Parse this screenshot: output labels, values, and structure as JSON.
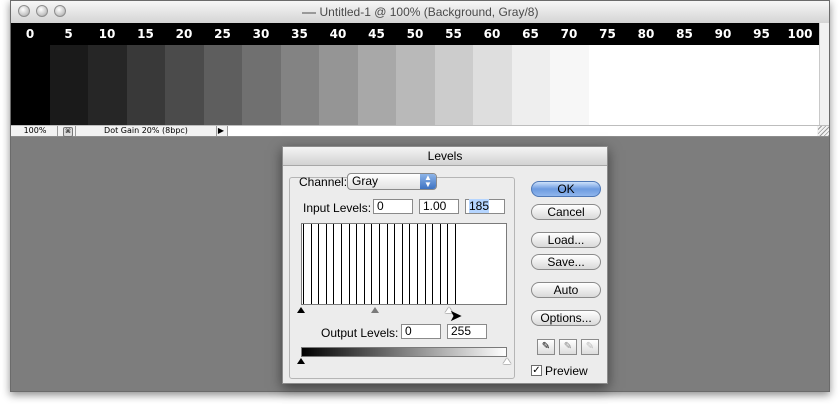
{
  "window": {
    "title": "Untitled-1 @ 100% (Background, Gray/8)"
  },
  "canvas": {
    "scale_labels": [
      "0",
      "5",
      "10",
      "15",
      "20",
      "25",
      "30",
      "35",
      "40",
      "45",
      "50",
      "55",
      "60",
      "65",
      "70",
      "75",
      "80",
      "85",
      "90",
      "95",
      "100"
    ],
    "swatch_colors": [
      "#000000",
      "#1a1a1a",
      "#262626",
      "#393939",
      "#4b4b4b",
      "#5e5e5e",
      "#707070",
      "#838383",
      "#959595",
      "#a8a8a8",
      "#b9b9b9",
      "#cccccc",
      "#dedede",
      "#eeeeee",
      "#f7f7f7",
      "#ffffff",
      "#ffffff",
      "#ffffff",
      "#ffffff",
      "#ffffff",
      "#ffffff"
    ]
  },
  "statusbar": {
    "zoom": "100%",
    "info": "Dot Gain 20% (8bpc)"
  },
  "dialog": {
    "title": "Levels",
    "channel_label": "Channel:",
    "channel_value": "Gray",
    "input_levels_label": "Input Levels:",
    "input_black": "0",
    "input_gamma": "1.00",
    "input_white": "185",
    "output_levels_label": "Output Levels:",
    "output_black": "0",
    "output_white": "255",
    "buttons": {
      "ok": "OK",
      "cancel": "Cancel",
      "load": "Load...",
      "save": "Save...",
      "auto": "Auto",
      "options": "Options..."
    },
    "preview_label": "Preview",
    "preview_checked": true
  }
}
